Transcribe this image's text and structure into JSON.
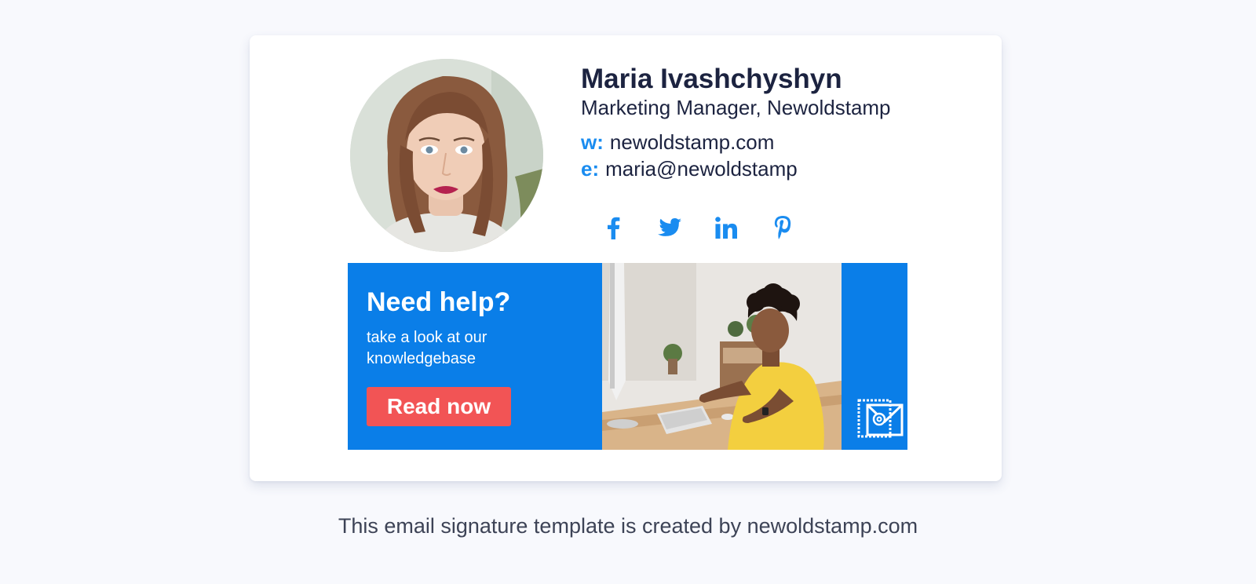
{
  "signature": {
    "name": "Maria Ivashchyshyn",
    "title": "Marketing Manager, Newoldstamp",
    "website": {
      "label": "w:",
      "value": "newoldstamp.com"
    },
    "email": {
      "label": "e:",
      "value": "maria@newoldstamp"
    },
    "socials": [
      "facebook-icon",
      "twitter-icon",
      "linkedin-icon",
      "pinterest-icon"
    ],
    "accent_color": "#1a8cf0",
    "name_color": "#1c2340"
  },
  "banner": {
    "title": "Need help?",
    "subtitle": "take a look at our knowledgebase",
    "button_label": "Read now",
    "background_color": "#0a7ee8",
    "button_color": "#f25455"
  },
  "footer": {
    "caption": "This email signature template is created by newoldstamp.com"
  }
}
